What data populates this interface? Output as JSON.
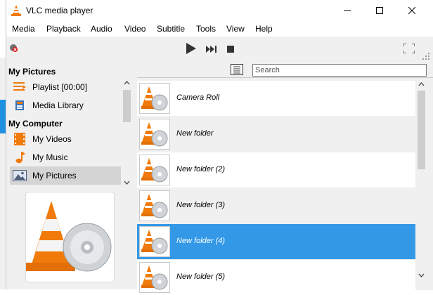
{
  "window": {
    "title": "VLC media player"
  },
  "menu": [
    "Media",
    "Playback",
    "Audio",
    "Video",
    "Subtitle",
    "Tools",
    "View",
    "Help"
  ],
  "search": {
    "placeholder": "Search"
  },
  "sidebar": {
    "sections": [
      {
        "header": "My Pictures",
        "items": [
          {
            "label": "Playlist [00:00]",
            "icon": "playlist-icon"
          },
          {
            "label": "Media Library",
            "icon": "media-library-icon"
          }
        ]
      },
      {
        "header": "My Computer",
        "items": [
          {
            "label": "My Videos",
            "icon": "film-icon"
          },
          {
            "label": "My Music",
            "icon": "music-note-icon"
          },
          {
            "label": "My Pictures",
            "icon": "picture-icon",
            "selected": true
          }
        ]
      }
    ]
  },
  "files": [
    {
      "name": "Camera Roll"
    },
    {
      "name": "New folder"
    },
    {
      "name": "New folder (2)"
    },
    {
      "name": "New folder (3)"
    },
    {
      "name": "New folder (4)",
      "selected": true
    },
    {
      "name": "New folder (5)"
    }
  ],
  "colors": {
    "selection": "#3399e6",
    "cone_orange": "#f07a0a"
  }
}
